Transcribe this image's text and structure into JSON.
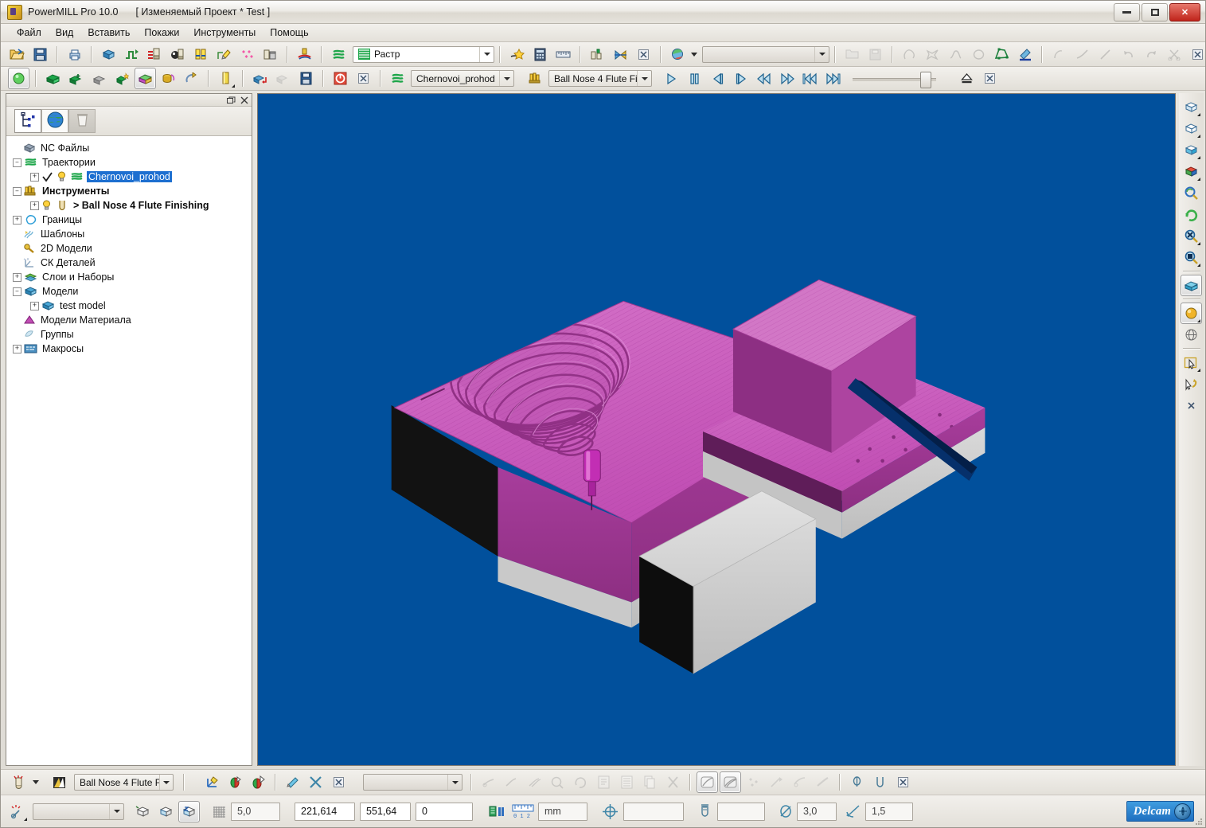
{
  "window": {
    "app_title": "PowerMILL Pro 10.0",
    "document_title": "[ Изменяемый Проект * Test ]",
    "app_icon": "powermill-logo-icon",
    "controls": {
      "minimize": "minimize-icon",
      "maximize": "maximize-icon",
      "close": "✕"
    }
  },
  "menu": {
    "items": [
      {
        "label": "Файл",
        "name": "menu-file"
      },
      {
        "label": "Вид",
        "name": "menu-view"
      },
      {
        "label": "Вставить",
        "name": "menu-insert"
      },
      {
        "label": "Покажи",
        "name": "menu-show"
      },
      {
        "label": "Инструменты",
        "name": "menu-tools"
      },
      {
        "label": "Помощь",
        "name": "menu-help"
      }
    ]
  },
  "toolbar_main": {
    "strategy_combo": {
      "value": "Растр",
      "icon": "raster-strategy-icon"
    },
    "blank_combo": {
      "value": "",
      "icon": "shading-icon"
    },
    "icons": [
      "open-project-icon",
      "save-project-icon",
      "print-icon",
      "block-icon",
      "rapid-move-icon",
      "tool-feed-icon",
      "tool-ball-icon",
      "tool-holder-icon",
      "leads-links-icon",
      "points-icon",
      "tool-bin-icon",
      "start-point-icon",
      "toolpath-icon",
      "delete-toolpath-icon",
      "calculator-icon",
      "measure-icon",
      "tool-database-icon",
      "simulate-icon",
      "close-toolbar-icon",
      "view-shade-icon",
      "undo-icon",
      "redo-icon",
      "curve-icon",
      "star-curve-icon",
      "spline-icon",
      "circle-icon",
      "boundary-icon",
      "paint-icon",
      "cut-icon",
      "trim-icon",
      "scissor-icon"
    ]
  },
  "toolbar_sim": {
    "toolpath_combo": {
      "value": "Chernovoi_prohod",
      "icon": "toolpath-icon"
    },
    "tool_combo": {
      "value": "Ball Nose 4 Flute Fi",
      "icon": "tool-icon"
    },
    "playback": [
      {
        "name": "play-button",
        "glyph": "play"
      },
      {
        "name": "pause-button",
        "glyph": "pause"
      },
      {
        "name": "step-back-button",
        "glyph": "step-back"
      },
      {
        "name": "step-forward-button",
        "glyph": "step-forward"
      },
      {
        "name": "rewind-button",
        "glyph": "rewind"
      },
      {
        "name": "fast-forward-button",
        "glyph": "fast-forward"
      },
      {
        "name": "go-to-start-button",
        "glyph": "to-start"
      },
      {
        "name": "go-to-end-button",
        "glyph": "to-end"
      }
    ],
    "speed_slider": {
      "value": 82
    },
    "eject_button": "eject-icon",
    "close_button": "close-toolbar-icon"
  },
  "explorer": {
    "tabs": [
      {
        "name": "tab-explorer-tree",
        "icon": "tree-icon",
        "selected": true
      },
      {
        "name": "tab-world",
        "icon": "globe-icon",
        "selected": false
      },
      {
        "name": "tab-recycle-bin",
        "icon": "trash-icon",
        "selected": false
      }
    ],
    "title_buttons": {
      "restore": "restore-icon",
      "close": "close-icon"
    },
    "tree": [
      {
        "label": "NC Файлы",
        "icon": "nc-files-icon",
        "depth": 0,
        "expander": "none",
        "selected": false,
        "bold": false
      },
      {
        "label": "Траектории",
        "icon": "toolpaths-icon",
        "depth": 0,
        "expander": "minus",
        "selected": false,
        "bold": false
      },
      {
        "label": "Chernovoi_prohod",
        "icon": "toolpath-item-icon",
        "depth": 1,
        "expander": "plus",
        "selected": true,
        "bold": false,
        "check": true,
        "bulb": true
      },
      {
        "label": "Инструменты",
        "icon": "tools-icon",
        "depth": 0,
        "expander": "minus",
        "selected": false,
        "bold": true
      },
      {
        "label": "> Ball Nose 4 Flute Finishing",
        "icon": "tool-item-icon",
        "depth": 1,
        "expander": "plus",
        "selected": false,
        "bold": true,
        "bulb": true
      },
      {
        "label": "Границы",
        "icon": "boundaries-icon",
        "depth": 0,
        "expander": "plus",
        "selected": false,
        "bold": false
      },
      {
        "label": "Шаблоны",
        "icon": "patterns-icon",
        "depth": 0,
        "expander": "none",
        "selected": false,
        "bold": false
      },
      {
        "label": "2D Модели",
        "icon": "2d-models-icon",
        "depth": 0,
        "expander": "none",
        "selected": false,
        "bold": false
      },
      {
        "label": "СК Деталей",
        "icon": "workplanes-icon",
        "depth": 0,
        "expander": "none",
        "selected": false,
        "bold": false
      },
      {
        "label": "Слои и Наборы",
        "icon": "levels-sets-icon",
        "depth": 0,
        "expander": "plus",
        "selected": false,
        "bold": false
      },
      {
        "label": "Модели",
        "icon": "models-icon",
        "depth": 0,
        "expander": "minus",
        "selected": false,
        "bold": false
      },
      {
        "label": "test model",
        "icon": "model-item-icon",
        "depth": 1,
        "expander": "plus",
        "selected": false,
        "bold": false
      },
      {
        "label": "Модели Материала",
        "icon": "stock-models-icon",
        "depth": 0,
        "expander": "none",
        "selected": false,
        "bold": false
      },
      {
        "label": "Группы",
        "icon": "groups-icon",
        "depth": 0,
        "expander": "none",
        "selected": false,
        "bold": false
      },
      {
        "label": "Макросы",
        "icon": "macros-icon",
        "depth": 0,
        "expander": "plus",
        "selected": false,
        "bold": false
      }
    ]
  },
  "viewport": {
    "background_color": "#01509c",
    "part_color": "#cc5fc0",
    "stock_color": "#d3d3d3",
    "tool_color": "#c12ab4",
    "description": "3D simulation of raster-machined pocket with concentric toolpath ridges, magenta part, grey stock blocks and a ball-nose tool"
  },
  "right_toolbar": {
    "icons": [
      "iso-view-1-icon",
      "iso-view-2-icon",
      "iso-view-3-icon",
      "view-cube-icon",
      "zoom-rotate-icon",
      "refresh-view-icon",
      "zoom-fit-icon",
      "zoom-box-icon",
      "shaded-view-icon",
      "material-shade-icon",
      "wireframe-icon",
      "select-arrow-icon",
      "undo-select-icon",
      "close-toolbar-icon"
    ]
  },
  "bottom_toolbar": {
    "tool_combo": {
      "value": "Ball Nose 4 Flute Fi",
      "icon": "tool-preview-icon"
    },
    "blank_combo": {
      "value": ""
    },
    "icons": [
      "tool-new-icon",
      "tool-edit-icon",
      "axis-icon",
      "collision-green-icon",
      "gouge-red-icon",
      "paint-tool-icon",
      "delete-tool-icon",
      "close-icon",
      "sim-step-icon",
      "sim-run-icon",
      "sim-multi-icon",
      "sim-hand-icon",
      "sim-rotate-icon",
      "report-icon",
      "list-icon",
      "copy-icon",
      "cut-icon",
      "shade-a-icon",
      "shade-b-icon",
      "sparkle-icon",
      "measure-tool-icon",
      "view-icon",
      "ribbon-icon",
      "probe-icon",
      "tool-tip-icon",
      "close-x-icon"
    ]
  },
  "status_bar": {
    "blank_combo": {
      "value": ""
    },
    "view_icons": [
      "block-view-icon",
      "block-shade-icon",
      "block-z-icon"
    ],
    "grid_icon": "grid-icon",
    "tolerance": "5,0",
    "coord_x": "221,614",
    "coord_y": "551,64",
    "coord_z": "0",
    "unit_icons": [
      "units-toggle-icon",
      "ruler-icon"
    ],
    "units": "mm",
    "crosshair_icon": "crosshair-icon",
    "spare_field": "",
    "tool_icon": "tool-status-icon",
    "diameter_icon": "diameter-icon",
    "diameter": "3,0",
    "tip_radius_icon": "tip-radius-icon",
    "tip_radius": "1,5",
    "brand": {
      "name": "Delcam",
      "logo": "delcam-orb-icon",
      "color": "#2f86d2"
    }
  }
}
